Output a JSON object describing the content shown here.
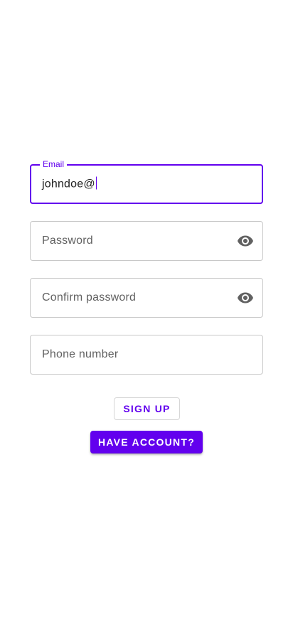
{
  "form": {
    "email": {
      "label": "Email",
      "value": "johndoe@"
    },
    "password": {
      "placeholder": "Password",
      "toggle_icon": "eye-icon"
    },
    "confirm_password": {
      "placeholder": "Confirm password",
      "toggle_icon": "eye-icon"
    },
    "phone": {
      "placeholder": "Phone number"
    }
  },
  "buttons": {
    "sign_up_label": "SIGN UP",
    "have_account_label": "HAVE ACCOUNT?"
  },
  "colors": {
    "accent": "#6200ee",
    "outline": "#c8c8c8",
    "icon": "#616161"
  }
}
